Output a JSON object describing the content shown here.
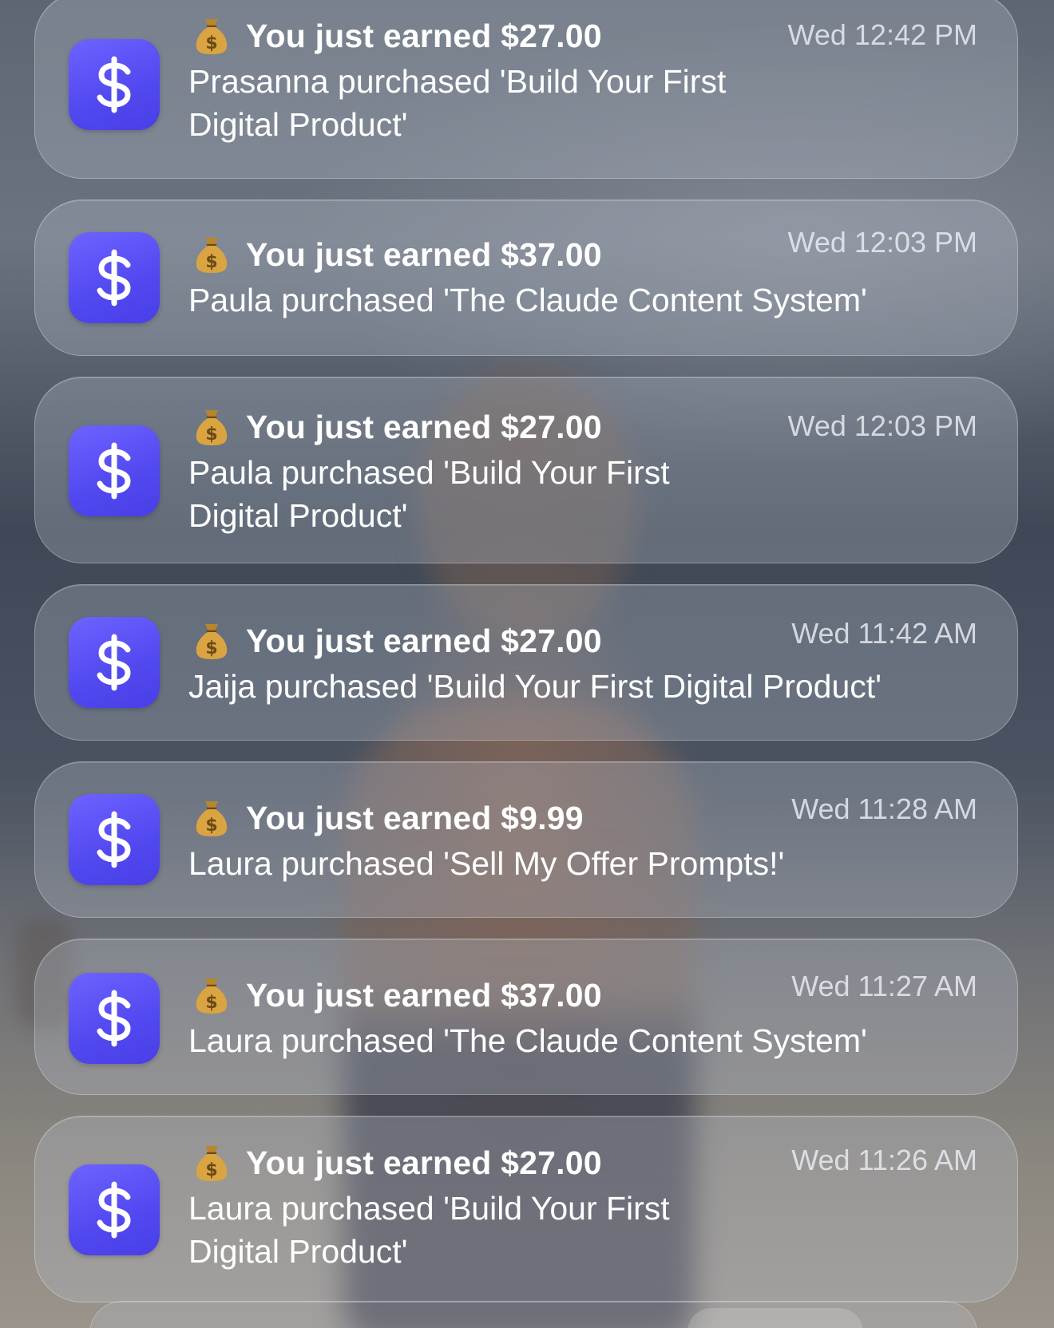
{
  "colors": {
    "app_icon": "#5a4ff5",
    "card_background": "rgba(185,192,205,0.30)",
    "text": "#ffffff",
    "time_text": "#e5e8ef"
  },
  "notifications": [
    {
      "icon": "dollar-sign-icon",
      "emoji": "money-bag-icon",
      "title": "You just earned $27.00",
      "time": "Wed 12:42 PM",
      "body": "Prasanna purchased 'Build Your First Digital Product'"
    },
    {
      "icon": "dollar-sign-icon",
      "emoji": "money-bag-icon",
      "title": "You just earned $37.00",
      "time": "Wed 12:03 PM",
      "body": "Paula purchased 'The Claude Content System'"
    },
    {
      "icon": "dollar-sign-icon",
      "emoji": "money-bag-icon",
      "title": "You just earned $27.00",
      "time": "Wed 12:03 PM",
      "body": "Paula purchased 'Build Your First Digital Product'"
    },
    {
      "icon": "dollar-sign-icon",
      "emoji": "money-bag-icon",
      "title": "You just earned $27.00",
      "time": "Wed 11:42 AM",
      "body": "Jaija purchased 'Build Your First Digital Product'"
    },
    {
      "icon": "dollar-sign-icon",
      "emoji": "money-bag-icon",
      "title": "You just earned $9.99",
      "time": "Wed 11:28 AM",
      "body": "Laura purchased 'Sell My Offer Prompts!'"
    },
    {
      "icon": "dollar-sign-icon",
      "emoji": "money-bag-icon",
      "title": "You just earned $37.00",
      "time": "Wed 11:27 AM",
      "body": "Laura purchased 'The Claude Content System'"
    },
    {
      "icon": "dollar-sign-icon",
      "emoji": "money-bag-icon",
      "title": "You just earned $27.00",
      "time": "Wed 11:26 AM",
      "body": "Laura purchased 'Build Your First Digital Product'"
    }
  ]
}
